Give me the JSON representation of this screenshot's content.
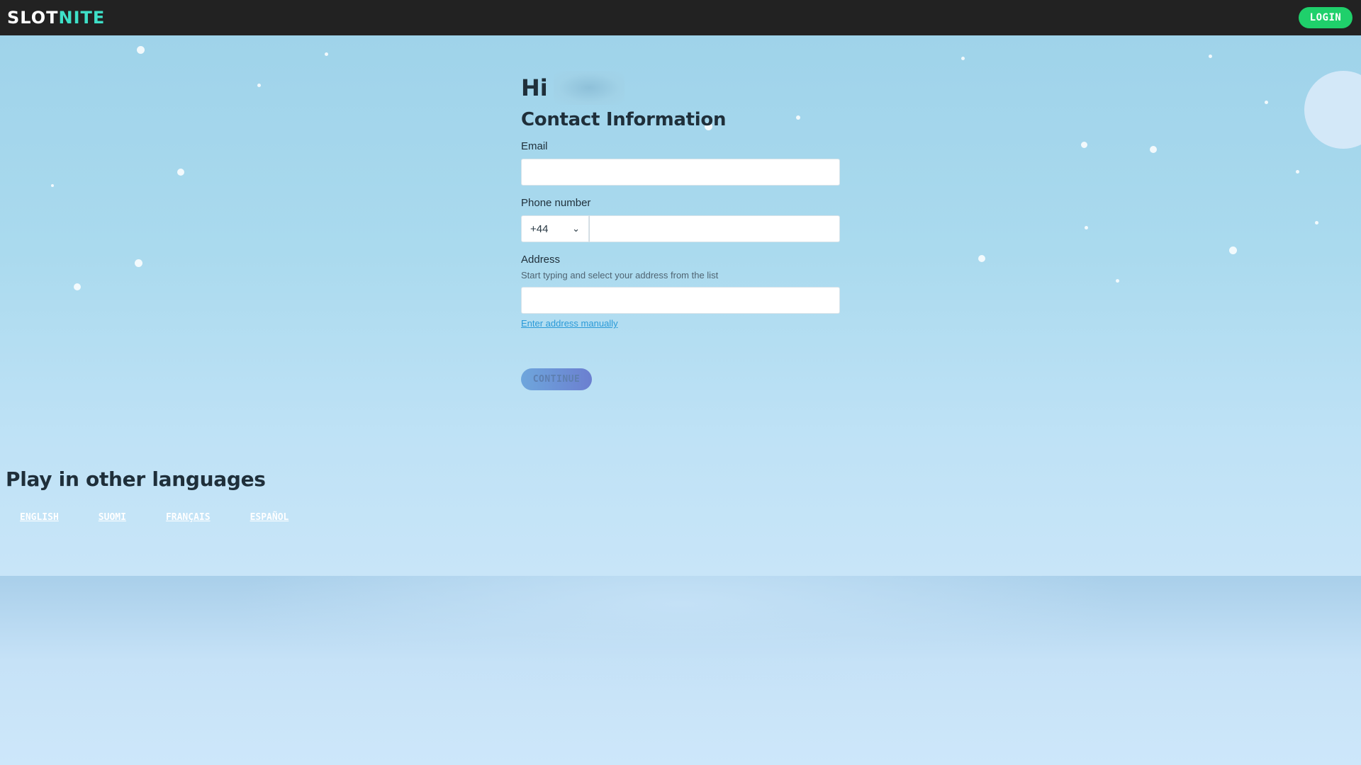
{
  "header": {
    "logo_part1": "SLOT",
    "logo_part2": "NITE",
    "login_label": "LOGIN"
  },
  "form": {
    "greeting": "Hi",
    "section_title": "Contact Information",
    "email_label": "Email",
    "email_value": "",
    "phone_label": "Phone number",
    "country_code": "+44",
    "phone_value": "",
    "address_label": "Address",
    "address_hint": "Start typing and select your address from the list",
    "address_value": "",
    "manual_link": "Enter address manually",
    "continue_label": "CONTINUE"
  },
  "languages": {
    "title": "Play in other languages",
    "items": [
      "ENGLISH",
      "SUOMI",
      "FRANÇAIS",
      "ESPAÑOL"
    ]
  },
  "colors": {
    "topbar": "#222222",
    "login": "#1fd06b",
    "link": "#2a9ad8",
    "sky": "#9fd3ea"
  }
}
